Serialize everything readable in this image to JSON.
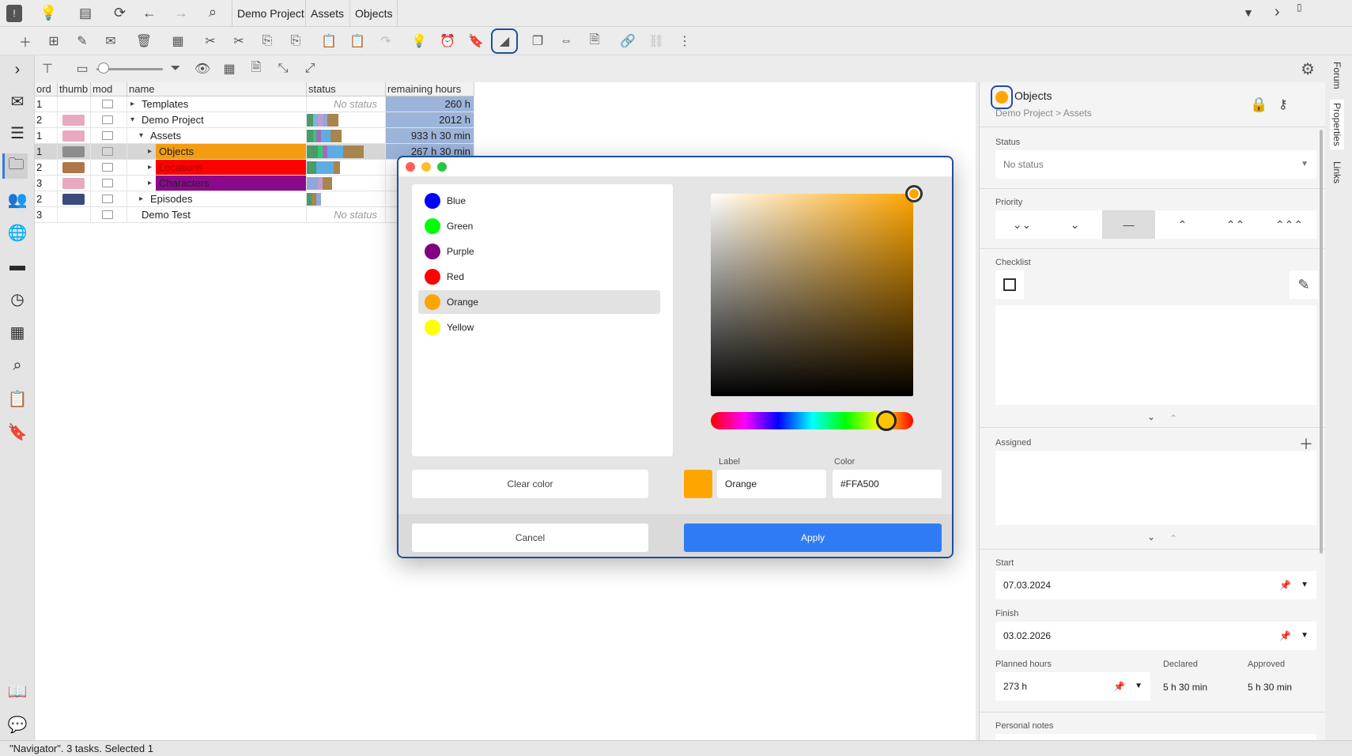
{
  "topbar": {
    "crumbs": [
      "Demo Project",
      "Assets",
      "Objects"
    ]
  },
  "tree": {
    "columns": [
      "ord",
      "thumb",
      "mod",
      "name",
      "status",
      "remaining hours"
    ],
    "rows": [
      {
        "ord": "1",
        "name": "Templates",
        "status": "No status",
        "hours": "260 h",
        "indent": 0,
        "expander": "▸",
        "hl": ""
      },
      {
        "ord": "2",
        "name": "Demo Project",
        "status": "",
        "hours": "2012 h",
        "indent": 0,
        "expander": "▾",
        "hl": ""
      },
      {
        "ord": "1",
        "name": "Assets",
        "status": "",
        "hours": "933 h 30 min",
        "indent": 1,
        "expander": "▾",
        "hl": ""
      },
      {
        "ord": "1",
        "name": "Objects",
        "status": "",
        "hours": "267 h 30 min",
        "indent": 2,
        "expander": "▸",
        "hl": "#f39c12"
      },
      {
        "ord": "2",
        "name": "Locations",
        "status": "",
        "hours": "",
        "indent": 2,
        "expander": "▸",
        "hl": "#ff0000"
      },
      {
        "ord": "3",
        "name": "Characters",
        "status": "",
        "hours": "",
        "indent": 2,
        "expander": "▸",
        "hl": "#8b0a8b"
      },
      {
        "ord": "2",
        "name": "Episodes",
        "status": "",
        "hours": "",
        "indent": 1,
        "expander": "▸",
        "hl": ""
      },
      {
        "ord": "3",
        "name": "Demo Test",
        "status": "No status",
        "hours": "",
        "indent": 0,
        "expander": "",
        "hl": ""
      }
    ]
  },
  "panel": {
    "title": "Objects",
    "breadcrumb": "Demo Project > Assets",
    "status_label": "Status",
    "status_value": "No status",
    "priority_label": "Priority",
    "checklist_label": "Checklist",
    "assigned_label": "Assigned",
    "start_label": "Start",
    "start_value": "07.03.2024",
    "finish_label": "Finish",
    "finish_value": "03.02.2026",
    "planned_label": "Planned hours",
    "planned_value": "273 h",
    "declared_label": "Declared",
    "declared_value": "5 h 30 min",
    "approved_label": "Approved",
    "approved_value": "5 h 30 min",
    "notes_label": "Personal notes"
  },
  "sidetabs": [
    "Forum",
    "Properties",
    "Links"
  ],
  "statusbar": "\"Navigator\". 3 tasks. Selected 1",
  "dialog": {
    "colors": [
      {
        "name": "Blue",
        "hex": "#0000ff"
      },
      {
        "name": "Green",
        "hex": "#00ff00"
      },
      {
        "name": "Purple",
        "hex": "#800080"
      },
      {
        "name": "Red",
        "hex": "#ff0000"
      },
      {
        "name": "Orange",
        "hex": "#ffa500"
      },
      {
        "name": "Yellow",
        "hex": "#ffff00"
      }
    ],
    "selected_index": 4,
    "clear_label": "Clear color",
    "label_caption": "Label",
    "label_value": "Orange",
    "color_caption": "Color",
    "color_value": "#FFA500",
    "cancel_label": "Cancel",
    "apply_label": "Apply"
  }
}
